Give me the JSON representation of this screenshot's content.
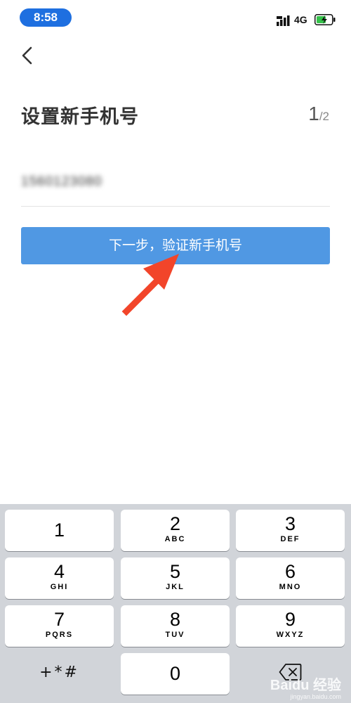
{
  "status_bar": {
    "time": "8:58",
    "network": "4G",
    "icons": [
      "signal-icon",
      "battery-charging-icon"
    ],
    "colors": {
      "time_pill": "#1e6fe0",
      "battery": "#35c24a"
    }
  },
  "nav": {
    "back_icon": "chevron-left-icon"
  },
  "header": {
    "title": "设置新手机号",
    "step_current": "1",
    "step_total": "/2"
  },
  "phone_input": {
    "value": "1560123080"
  },
  "primary_button": {
    "label": "下一步，验证新手机号",
    "color": "#5098e3"
  },
  "annotation": {
    "icon": "red-arrow-icon",
    "color": "#f2452a"
  },
  "keypad": {
    "keys": [
      {
        "digit": "1",
        "letters": ""
      },
      {
        "digit": "2",
        "letters": "ABC"
      },
      {
        "digit": "3",
        "letters": "DEF"
      },
      {
        "digit": "4",
        "letters": "GHI"
      },
      {
        "digit": "5",
        "letters": "JKL"
      },
      {
        "digit": "6",
        "letters": "MNO"
      },
      {
        "digit": "7",
        "letters": "PQRS"
      },
      {
        "digit": "8",
        "letters": "TUV"
      },
      {
        "digit": "9",
        "letters": "WXYZ"
      },
      {
        "digit": "0",
        "letters": ""
      }
    ],
    "symbols_label": "+*#",
    "delete_icon": "backspace-icon"
  },
  "watermark": {
    "main": "Baidu 经验",
    "sub": "jingyan.baidu.com"
  }
}
